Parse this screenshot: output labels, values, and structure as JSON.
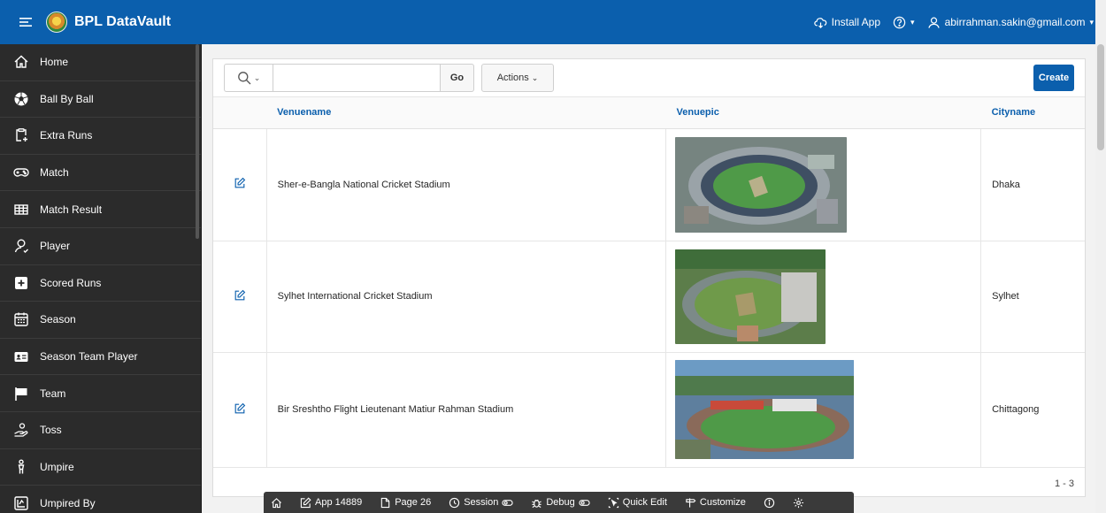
{
  "header": {
    "title": "BPL DataVault",
    "install_label": "Install App",
    "user_email": "abirrahman.sakin@gmail.com"
  },
  "sidebar": {
    "items": [
      {
        "label": "Home",
        "icon": "home-icon"
      },
      {
        "label": "Ball By Ball",
        "icon": "soccer-ball-icon"
      },
      {
        "label": "Extra Runs",
        "icon": "add-clipboard-icon"
      },
      {
        "label": "Match",
        "icon": "gamepad-icon"
      },
      {
        "label": "Match Result",
        "icon": "table-icon"
      },
      {
        "label": "Player",
        "icon": "user-icon"
      },
      {
        "label": "Scored Runs",
        "icon": "plus-square-icon"
      },
      {
        "label": "Season",
        "icon": "calendar-icon"
      },
      {
        "label": "Season Team Player",
        "icon": "id-card-icon"
      },
      {
        "label": "Team",
        "icon": "flag-icon"
      },
      {
        "label": "Toss",
        "icon": "coin-hand-icon"
      },
      {
        "label": "Umpire",
        "icon": "person-icon"
      },
      {
        "label": "Umpired By",
        "icon": "checkbox-icon"
      }
    ]
  },
  "report": {
    "search_placeholder": "",
    "go_label": "Go",
    "actions_label": "Actions",
    "create_label": "Create",
    "columns": [
      "Venuename",
      "Venuepic",
      "Cityname"
    ],
    "rows": [
      {
        "venue": "Sher-e-Bangla National Cricket Stadium",
        "city": "Dhaka"
      },
      {
        "venue": "Sylhet International Cricket Stadium",
        "city": "Sylhet"
      },
      {
        "venue": "Bir Sreshtho Flight Lieutenant Matiur Rahman Stadium",
        "city": "Chittagong"
      }
    ],
    "pagination": "1 - 3"
  },
  "devbar": {
    "app_label": "App 14889",
    "page_label": "Page 26",
    "session_label": "Session",
    "debug_label": "Debug",
    "quick_edit_label": "Quick Edit",
    "customize_label": "Customize"
  },
  "colors": {
    "header_bg": "#0b5fad",
    "sidebar_bg": "#2b2b2b",
    "link": "#0b5fad"
  }
}
